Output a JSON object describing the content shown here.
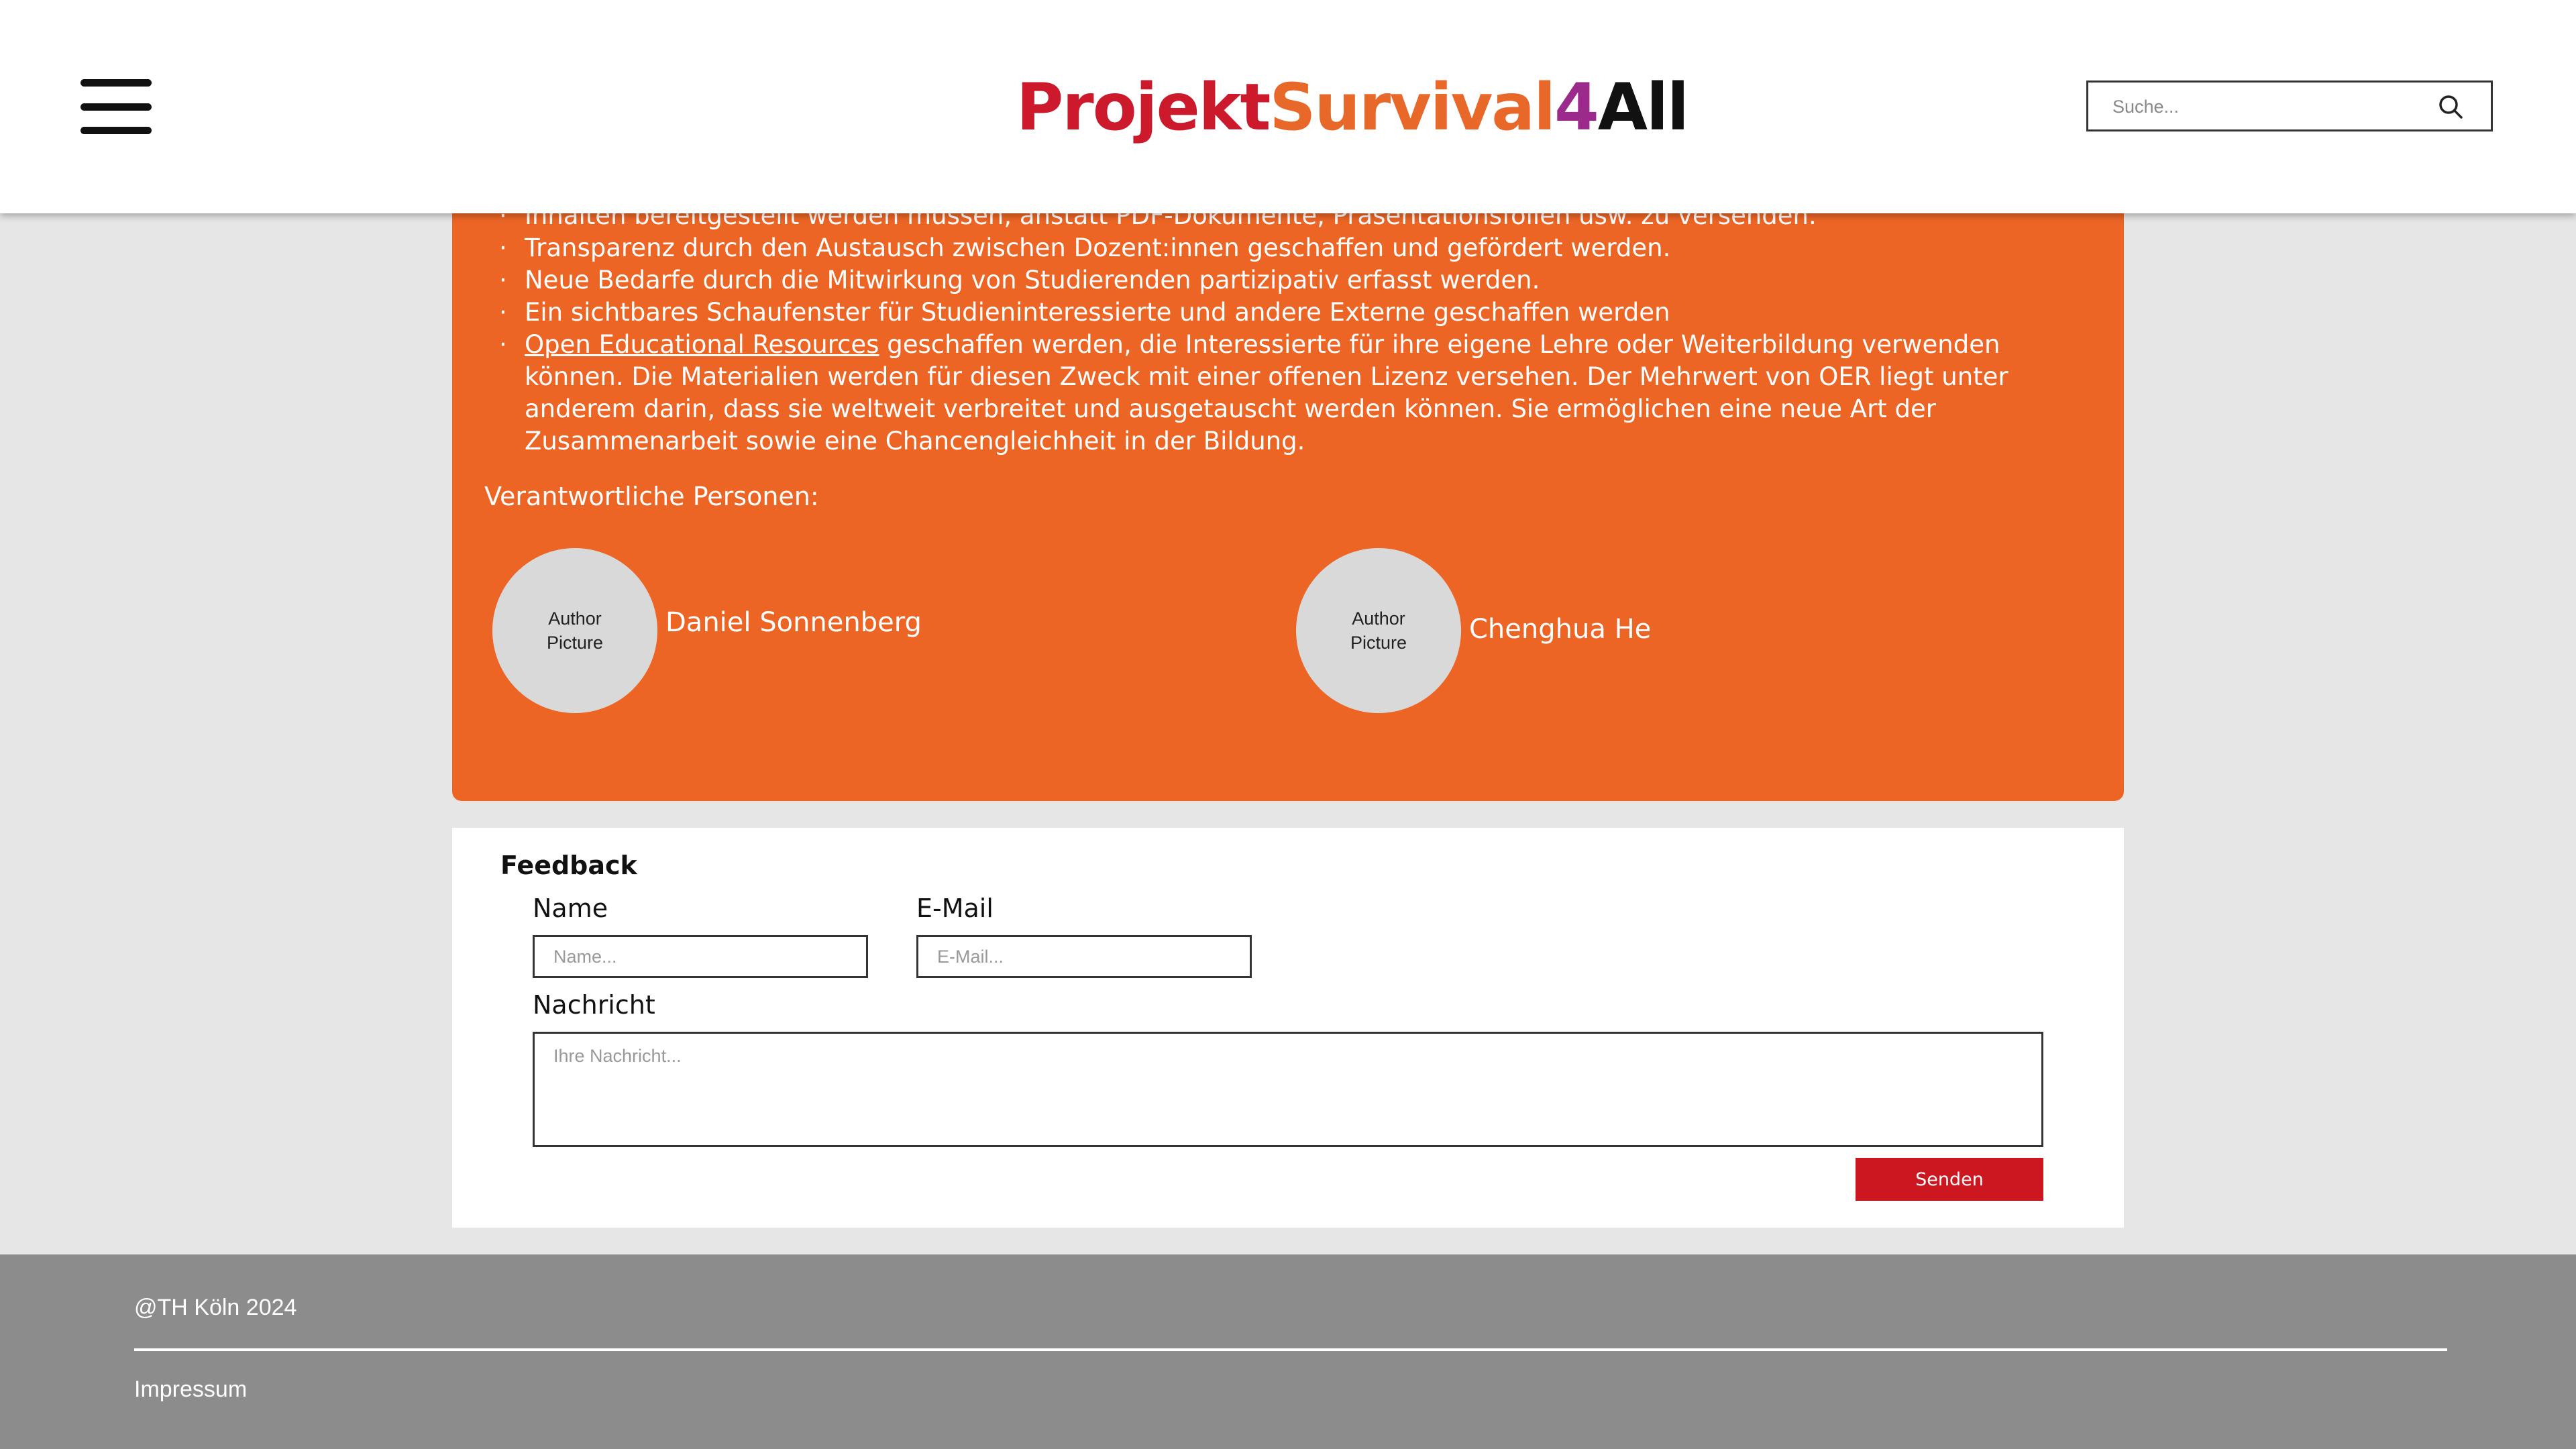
{
  "header": {
    "logo": {
      "part1": "Projekt",
      "part2": "Survival",
      "part3": "4",
      "part4": "All",
      "colors": {
        "part1": "#cc1a2c",
        "part2": "#e8682a",
        "part3": "#9c2a8c",
        "part4": "#111111"
      }
    },
    "menu_icon": "hamburger-menu-icon",
    "search": {
      "placeholder": "Suche...",
      "icon": "search-icon"
    }
  },
  "content": {
    "bullets": [
      "Inhalten bereitgestellt werden müssen, anstatt PDF-Dokumente, Präsentationsfolien usw. zu versenden.",
      "Transparenz durch den Austausch zwischen Dozent:innen geschaffen und gefördert werden.",
      "Neue Bedarfe durch die Mitwirkung von Studierenden partizipativ erfasst werden.",
      "Ein sichtbares Schaufenster für Studieninteressierte und andere Externe geschaffen werden"
    ],
    "oer_bullet": {
      "link": "Open Educational Resources",
      "text": " geschaffen werden, die Interessierte für ihre eigene Lehre oder Weiterbildung verwenden können. Die Materialien werden für diesen Zweck mit einer offenen Lizenz versehen. Der Mehrwert von OER liegt unter anderem darin, dass sie weltweit verbreitet und ausgetauscht werden können. Sie ermöglichen eine neue Art der Zusammenarbeit sowie eine Chancengleichheit in der Bildung."
    },
    "responsible_label": "Verantwortliche Personen:",
    "authors": [
      {
        "picture_line1": "Author",
        "picture_line2": "Picture",
        "name": "Daniel Sonnenberg"
      },
      {
        "picture_line1": "Author",
        "picture_line2": "Picture",
        "name": "Chenghua He"
      }
    ],
    "panel_color": "#ec6525"
  },
  "feedback": {
    "title": "Feedback",
    "name_label": "Name",
    "name_placeholder": "Name...",
    "email_label": "E-Mail",
    "email_placeholder": "E-Mail...",
    "message_label": "Nachricht",
    "message_placeholder": "Ihre Nachricht...",
    "send_label": "Senden",
    "send_color": "#cc1720"
  },
  "footer": {
    "copyright": "@TH Köln 2024",
    "impressum": "Impressum"
  }
}
